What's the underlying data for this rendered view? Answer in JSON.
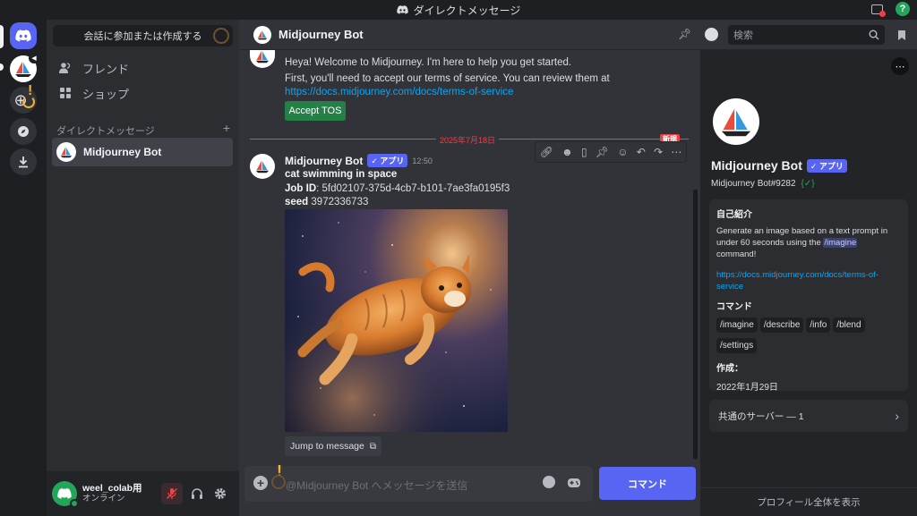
{
  "window": {
    "title": "ダイレクトメッセージ"
  },
  "sidebar": {
    "search_button": "会話に参加または作成する",
    "nav": [
      {
        "label": "フレンド"
      },
      {
        "label": "ショップ"
      }
    ],
    "dm_header": "ダイレクトメッセージ",
    "dm_add": "+",
    "dm_items": [
      {
        "name": "Midjourney Bot"
      }
    ]
  },
  "user": {
    "name": "weel_colab用",
    "status": "オンライン"
  },
  "chat": {
    "header_name": "Midjourney Bot",
    "search_placeholder": "検索",
    "first_message": {
      "author": "Midjourney Bot",
      "line1": "Heya! Welcome to Midjourney. I'm here to help you get started.",
      "line2": "First, you'll need to accept our terms of service. You can review them at",
      "link": "https://docs.midjourney.com/docs/terms-of-service",
      "button": "Accept TOS"
    },
    "divider": {
      "date": "2025年7月18日",
      "new_badge": "新規"
    },
    "second_message": {
      "author": "Midjourney Bot",
      "badge": "✓ アプリ",
      "time": "12:50",
      "prompt": "cat swimming in space",
      "job_label": "Job ID",
      "job_id": ": 5fd02107-375d-4cb7-b101-7ae3fa0195f3",
      "seed_label": "seed",
      "seed": " 3972336733",
      "jump_button": "Jump to message"
    },
    "input_placeholder": "@Midjourney Bot へメッセージを送信",
    "command_button": "コマンド"
  },
  "profile": {
    "name": "Midjourney Bot",
    "badge": "✓ アプリ",
    "tag": "Midjourney Bot#9282",
    "about_title": "自己紹介",
    "about_line1": "Generate an image based on a text prompt in",
    "about_line2": "under 60 seconds using the",
    "about_cmd": "/imagine",
    "about_line3": "command!",
    "link_line1": "https://docs.midjourney.com/docs/terms-of-",
    "link_line2": "service",
    "commands_title": "コマンド",
    "commands": [
      "/imagine",
      "/describe",
      "/info",
      "/blend",
      "/settings"
    ],
    "created_title": "作成：",
    "created": "2022年1月29日",
    "mutual_servers": "共通のサーバー — 1",
    "view_full": "プロフィール全体を表示"
  },
  "colors": {
    "accent": "#5865f2",
    "green": "#248046",
    "link": "#00a8fc",
    "divider_red": "#f23f43"
  }
}
